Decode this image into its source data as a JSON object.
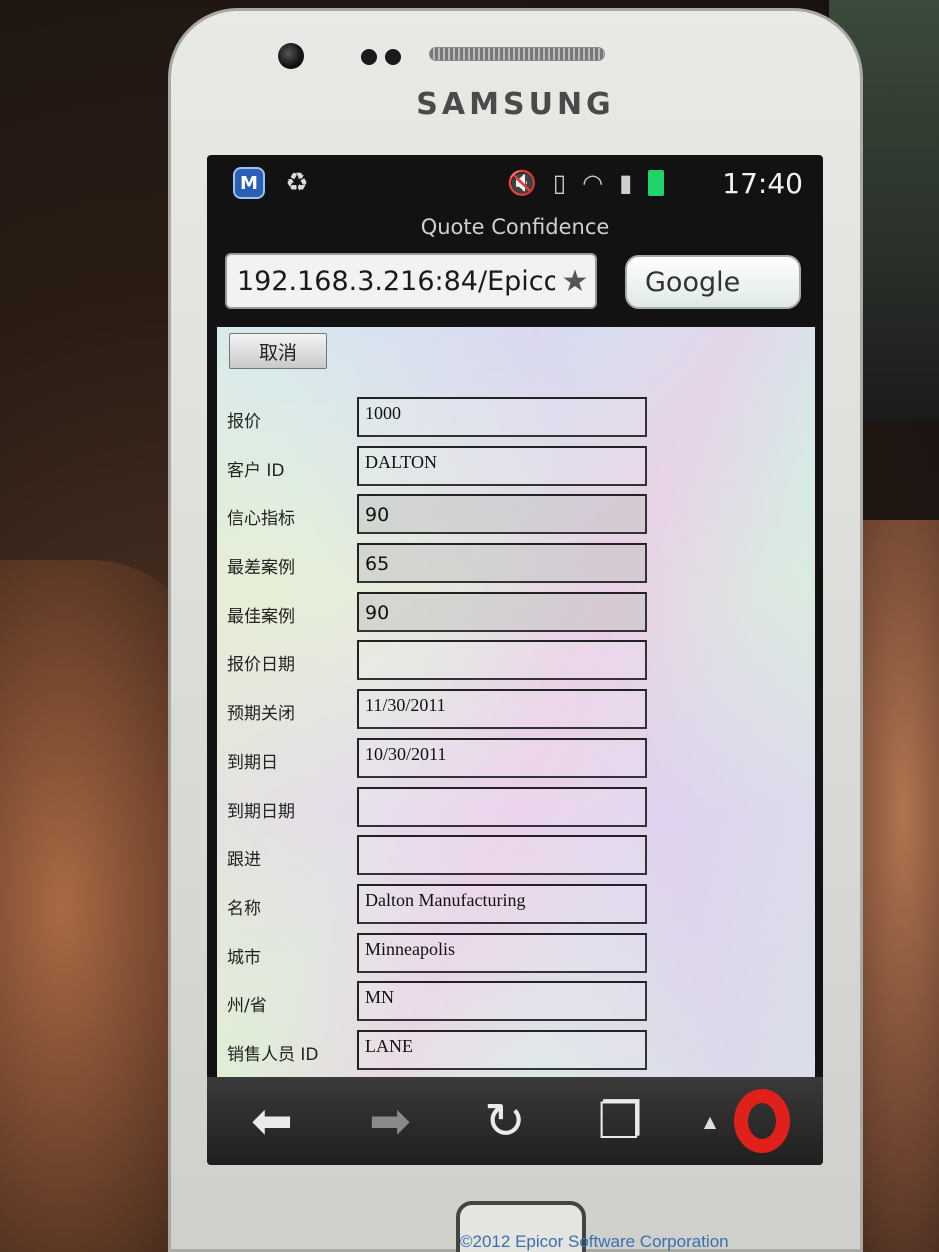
{
  "device": {
    "brand": "SAMSUNG"
  },
  "status_bar": {
    "time": "17:40",
    "left_icons": [
      "shield-icon",
      "recycle-icon"
    ],
    "right_icons": [
      "mute-icon",
      "vibrate-icon",
      "wifi-icon",
      "signal-icon",
      "battery-icon"
    ],
    "battery_color": "#1fd46a"
  },
  "browser": {
    "page_title": "Quote Confidence",
    "url": "192.168.3.216:84/Epico",
    "search_placeholder": "Google",
    "toolbar": [
      "back-arrow-icon",
      "forward-arrow-icon",
      "reload-icon",
      "tabs-icon",
      "menu-caret-icon",
      "opera-logo"
    ]
  },
  "form": {
    "cancel_label": "取消",
    "fields": [
      {
        "label": "报价",
        "value": "1000"
      },
      {
        "label": "客户 ID",
        "value": "DALTON"
      },
      {
        "label": "信心指标",
        "value": "90"
      },
      {
        "label": "最差案例",
        "value": "65"
      },
      {
        "label": "最佳案例",
        "value": "90"
      },
      {
        "label": "报价日期",
        "value": ""
      },
      {
        "label": "预期关闭",
        "value": "11/30/2011"
      },
      {
        "label": "到期日",
        "value": "10/30/2011"
      },
      {
        "label": "到期日期",
        "value": ""
      },
      {
        "label": "跟进",
        "value": ""
      },
      {
        "label": "名称",
        "value": "Dalton Manufacturing"
      },
      {
        "label": "城市",
        "value": "Minneapolis"
      },
      {
        "label": "州/省",
        "value": "MN"
      },
      {
        "label": "销售人员 ID",
        "value": "LANE"
      }
    ]
  },
  "footer": {
    "copyright": "©2012 Epicor Software Corporation"
  }
}
